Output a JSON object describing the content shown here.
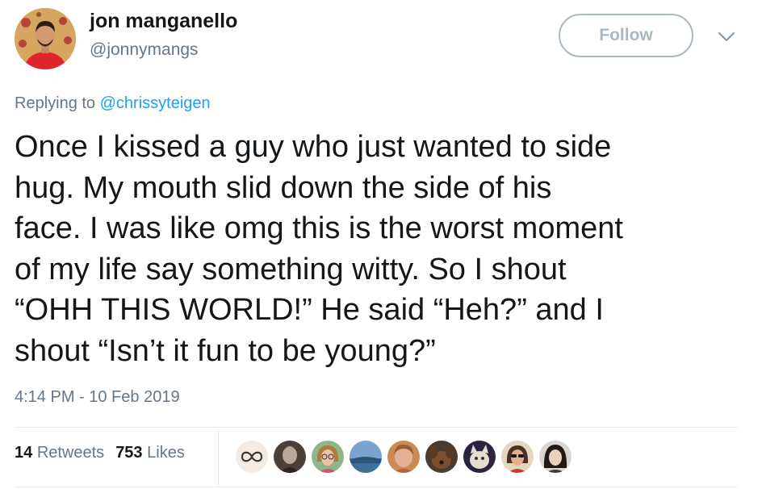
{
  "author": {
    "name": "jon manganello",
    "handle": "@jonnymangs",
    "avatar_icon": "profile-photo-avatar"
  },
  "follow_button": {
    "label": "Follow"
  },
  "menu": {
    "icon": "chevron-down-icon"
  },
  "reply": {
    "prefix": "Replying to",
    "mention": "@chrissyteigen"
  },
  "tweet": {
    "lines": [
      "Once I kissed a guy who just wanted to side",
      "hug. My mouth slid down the side of his",
      "face. I was like omg this is the worst moment",
      "of my life say something witty. So I shout",
      "“OHH THIS WORLD!” He said “Heh?” and I",
      "shout “Isn’t it fun to be young?”"
    ],
    "timestamp": "4:14 PM - 10 Feb 2019"
  },
  "stats": {
    "retweets_count": "14",
    "retweets_label": "Retweets",
    "likes_count": "753",
    "likes_label": "Likes"
  },
  "likers": [
    {
      "icon": "infinity-logo-avatar"
    },
    {
      "icon": "vintage-photo-avatar"
    },
    {
      "icon": "woman-glasses-avatar"
    },
    {
      "icon": "landscape-avatar"
    },
    {
      "icon": "older-woman-avatar"
    },
    {
      "icon": "dog-avatar"
    },
    {
      "icon": "cat-avatar"
    },
    {
      "icon": "woman-sunglasses-avatar"
    },
    {
      "icon": "woman-dark-hair-avatar"
    }
  ],
  "colors": {
    "text": "#14171a",
    "secondary": "#657786",
    "link": "#1da1f2",
    "follow_border": "#aab8c2",
    "divider": "#e6ecf0"
  }
}
